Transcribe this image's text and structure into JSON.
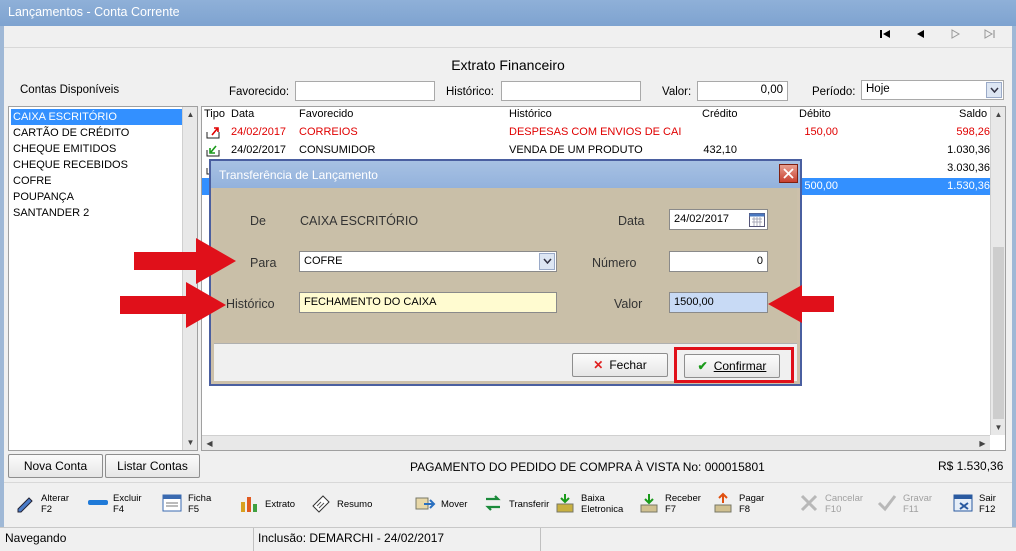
{
  "window": {
    "title": "Lançamentos - Conta Corrente"
  },
  "extrato_title": "Extrato Financeiro",
  "filters": {
    "contas_label": "Contas Disponíveis",
    "favorecido_label": "Favorecido:",
    "favorecido_value": "",
    "historico_label": "Histórico:",
    "historico_value": "",
    "valor_label": "Valor:",
    "valor_value": "0,00",
    "periodo_label": "Período:",
    "periodo_value": "Hoje"
  },
  "accounts": [
    "CAIXA ESCRITÓRIO",
    "CARTÃO DE CRÉDITO",
    "CHEQUE EMITIDOS",
    "CHEQUE RECEBIDOS",
    "COFRE",
    "POUPANÇA",
    "SANTANDER 2"
  ],
  "grid": {
    "headers": [
      "Tipo",
      "Data",
      "Favorecido",
      "Histórico",
      "Crédito",
      "Débito",
      "Saldo"
    ],
    "rows": [
      {
        "data": "24/02/2017",
        "favorecido": "CORREIOS",
        "historico": "DESPESAS COM ENVIOS DE CAI",
        "credito": "",
        "debito": "150,00",
        "saldo": "598,26",
        "color": "#e00000"
      },
      {
        "data": "24/02/2017",
        "favorecido": "CONSUMIDOR",
        "historico": "VENDA DE UM PRODUTO",
        "credito": "432,10",
        "debito": "",
        "saldo": "1.030,36",
        "color": "#000000"
      },
      {
        "data": "",
        "favorecido": "",
        "historico": "",
        "credito": "",
        "debito": "",
        "saldo": "3.030,36",
        "color": "#000000"
      },
      {
        "data": "",
        "favorecido": "",
        "historico": "",
        "credito": "",
        "debito": "500,00",
        "saldo": "1.530,36",
        "color": "#ffffff"
      }
    ]
  },
  "buttons": {
    "nova_conta": "Nova Conta",
    "listar_contas": "Listar Contas"
  },
  "footer_info": {
    "description": "PAGAMENTO DO PEDIDO DE COMPRA À VISTA No: 000015801",
    "total": "R$ 1.530,36"
  },
  "toolbar": [
    {
      "label": "Alterar",
      "key": "F2",
      "icon": "pencil-icon"
    },
    {
      "label": "Excluir",
      "key": "F4",
      "icon": "minus-bar-icon"
    },
    {
      "label": "Ficha",
      "key": "F5",
      "icon": "form-icon"
    },
    {
      "label": "Extrato",
      "key": "",
      "icon": "chart-bars-icon"
    },
    {
      "label": "Resumo",
      "key": "",
      "icon": "checkbook-icon"
    },
    {
      "label": "Mover",
      "key": "",
      "icon": "move-icon"
    },
    {
      "label": "Transferir",
      "key": "",
      "icon": "transfer-arrows-icon"
    },
    {
      "label": "Baixa\nEletronica",
      "key": "",
      "icon": "money-down-icon"
    },
    {
      "label": "Receber",
      "key": "F7",
      "icon": "receive-icon"
    },
    {
      "label": "Pagar",
      "key": "F8",
      "icon": "pay-icon"
    },
    {
      "label": "Cancelar",
      "key": "F10",
      "icon": "cancel-x-icon"
    },
    {
      "label": "Gravar",
      "key": "F11",
      "icon": "save-check-icon"
    },
    {
      "label": "Sair",
      "key": "F12",
      "icon": "exit-icon"
    }
  ],
  "status": {
    "mode": "Navegando",
    "inclusao": "Inclusão: DEMARCHI - 24/02/2017"
  },
  "dialog": {
    "title": "Transferência de Lançamento",
    "de_label": "De",
    "de_value": "CAIXA ESCRITÓRIO",
    "data_label": "Data",
    "data_value": "24/02/2017",
    "para_label": "Para",
    "para_value": "COFRE",
    "numero_label": "Número",
    "numero_value": "0",
    "historico_label": "Histórico",
    "historico_value": "FECHAMENTO DO CAIXA",
    "valor_label": "Valor",
    "valor_value": "1500,00",
    "fechar_label": "Fechar",
    "confirmar_label": "Confirmar"
  },
  "colors": {
    "accent": "#3390ff",
    "highlight": "#e0101a",
    "dialog_bg": "#c9bfa8",
    "historico_field_bg": "#fffbd0",
    "valor_field_bg": "#c8daf5"
  }
}
